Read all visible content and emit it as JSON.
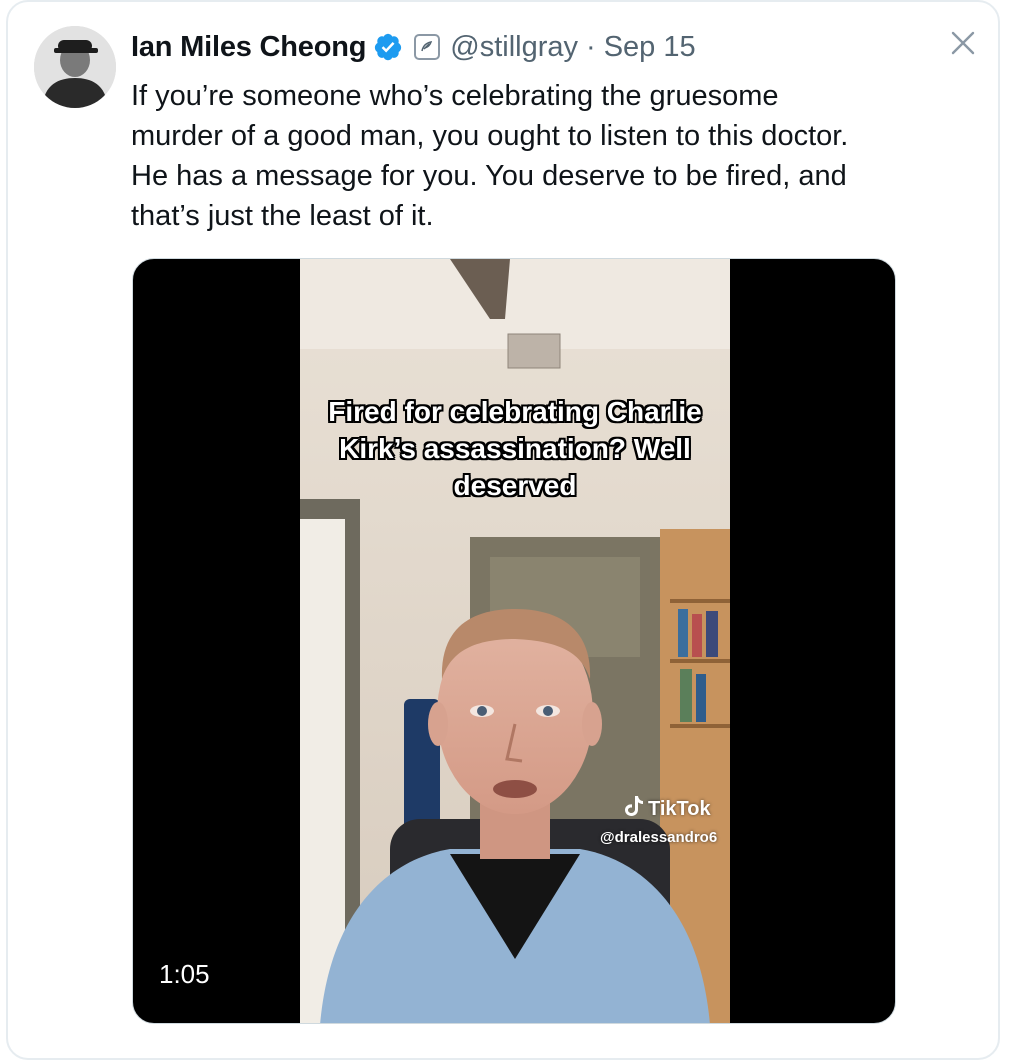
{
  "tweet": {
    "author": {
      "display_name": "Ian Miles Cheong",
      "handle": "@stillgray",
      "verified": true
    },
    "separator": "·",
    "date": "Sep 15",
    "text": "If you’re someone who’s celebrating the gruesome murder of a good man, you ought to listen to this doctor. He has a message for you. You deserve to be fired, and that’s just the least of it."
  },
  "media": {
    "type": "video",
    "duration": "1:05",
    "caption": "Fired for celebrating Charlie Kirk’s assassination? Well deserved",
    "watermark_brand": "TikTok",
    "watermark_handle": "@dralessandro6"
  },
  "icons": {
    "verified": "verified-badge-icon",
    "affiliation": "affiliate-badge-icon",
    "close": "close-icon"
  },
  "colors": {
    "text": "#0f1419",
    "secondary": "#536471",
    "verified": "#1d9bf0"
  }
}
